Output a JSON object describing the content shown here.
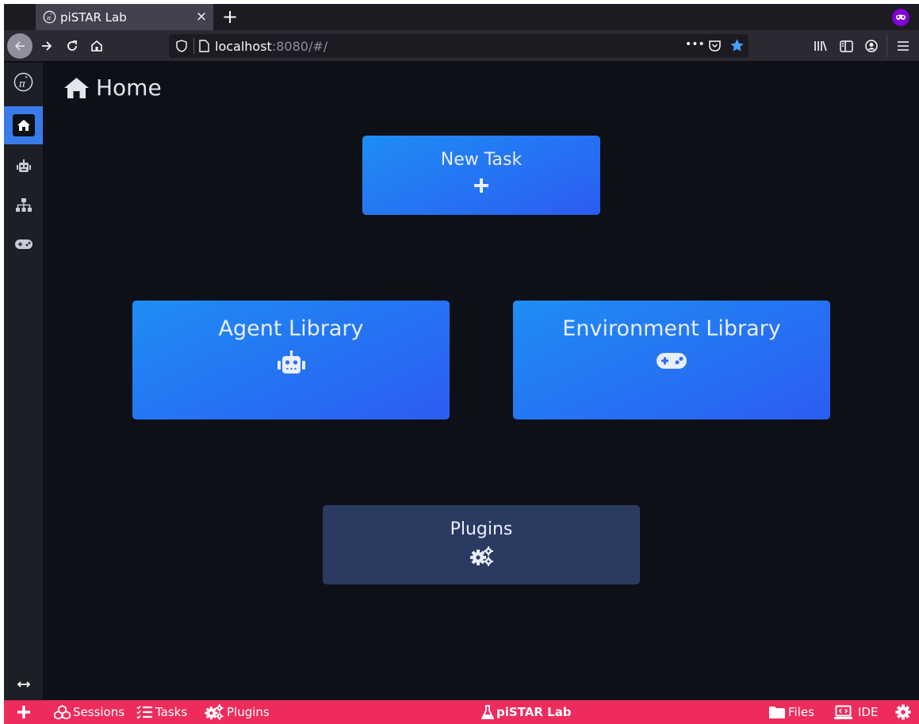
{
  "browser": {
    "tab_title": "piSTAR Lab",
    "tab_close": "×",
    "new_tab": "+",
    "url_host": "localhost",
    "url_rest": ":8080/#/",
    "url_more": "•••"
  },
  "page": {
    "title": "Home"
  },
  "cards": {
    "new_task": {
      "label": "New Task",
      "icon": "plus-icon"
    },
    "agent_library": {
      "label": "Agent Library",
      "icon": "robot-icon"
    },
    "environment_library": {
      "label": "Environment Library",
      "icon": "gamepad-icon"
    },
    "plugins": {
      "label": "Plugins",
      "icon": "cogs-icon"
    }
  },
  "sidebar": {
    "items": [
      {
        "name": "logo",
        "icon": "pi-logo-icon"
      },
      {
        "name": "home",
        "icon": "home-icon",
        "active": true
      },
      {
        "name": "agents",
        "icon": "robot-icon"
      },
      {
        "name": "components",
        "icon": "sitemap-icon"
      },
      {
        "name": "environments",
        "icon": "gamepad-icon"
      }
    ],
    "expand_icon": "arrows-h-icon"
  },
  "bottombar": {
    "sessions": "Sessions",
    "tasks": "Tasks",
    "plugins": "Plugins",
    "app_name": "piSTAR Lab",
    "files": "Files",
    "ide": "IDE"
  },
  "colors": {
    "accent": "#3a7bea",
    "bottombar": "#ee2c5c",
    "card_gradient_start": "#1e8df4",
    "card_gradient_end": "#2c5cf2",
    "plugins_card": "#2b3a61",
    "background": "#0d1017"
  }
}
